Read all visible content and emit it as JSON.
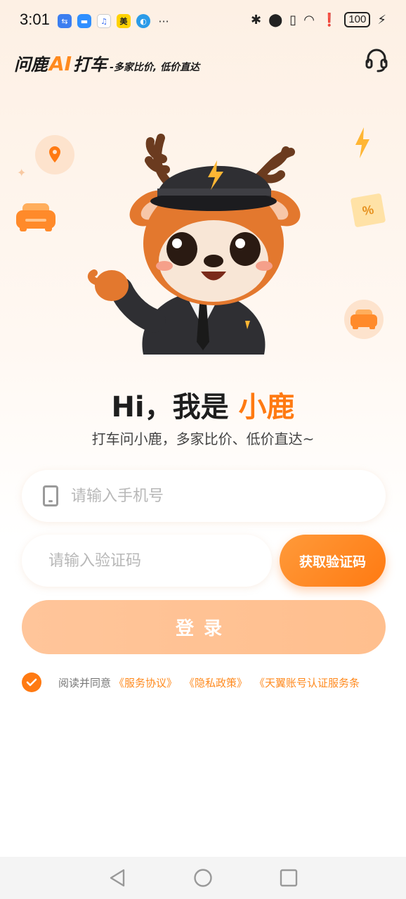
{
  "status_bar": {
    "time": "3:01",
    "battery": "100",
    "notification_icons": [
      "usb-icon",
      "message-icon",
      "music-icon",
      "meituan-icon",
      "browser-icon",
      "more-icon"
    ],
    "more": "···",
    "mei": "美"
  },
  "header": {
    "logo_main": "问鹿",
    "logo_ai": "AI",
    "logo_main2": "打车",
    "logo_tagline": "-多家比价, 低价直达"
  },
  "decorations": {
    "percent": "%"
  },
  "greeting": {
    "prefix": "Hi，我是 ",
    "highlight": "小鹿",
    "subtitle": "打车问小鹿，多家比价、低价直达~"
  },
  "form": {
    "phone_placeholder": "请输入手机号",
    "phone_value": "",
    "code_placeholder": "请输入验证码",
    "code_value": "",
    "get_code_label": "获取验证码",
    "login_label": "登录"
  },
  "agreement": {
    "checked": true,
    "prefix": "阅读并同意",
    "links": [
      "《服务协议》",
      "《隐私政策》",
      "《天翼账号认证服务条"
    ]
  },
  "colors": {
    "accent": "#ff7a12",
    "login_disabled": "#ffc59a"
  }
}
